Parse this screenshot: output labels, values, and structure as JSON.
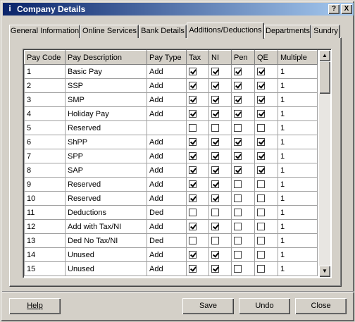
{
  "window": {
    "title": "Company Details",
    "help_btn": "?",
    "close_btn": "X",
    "title_icon": "i"
  },
  "tabs": [
    {
      "label": "General Information"
    },
    {
      "label": "Online Services"
    },
    {
      "label": "Bank Details"
    },
    {
      "label": "Additions/Deductions",
      "active": true
    },
    {
      "label": "Departments"
    },
    {
      "label": "Sundry"
    }
  ],
  "grid": {
    "headers": [
      "Pay Code",
      "Pay Description",
      "Pay Type",
      "Tax",
      "NI",
      "Pen",
      "QE",
      "Multiple"
    ],
    "rows": [
      {
        "code": "1",
        "desc": "Basic Pay",
        "type": "Add",
        "tax": true,
        "ni": true,
        "pen": true,
        "qe": true,
        "mult": "1"
      },
      {
        "code": "2",
        "desc": "SSP",
        "type": "Add",
        "tax": true,
        "ni": true,
        "pen": true,
        "qe": true,
        "mult": "1"
      },
      {
        "code": "3",
        "desc": "SMP",
        "type": "Add",
        "tax": true,
        "ni": true,
        "pen": true,
        "qe": true,
        "mult": "1"
      },
      {
        "code": "4",
        "desc": "Holiday Pay",
        "type": "Add",
        "tax": true,
        "ni": true,
        "pen": true,
        "qe": true,
        "mult": "1"
      },
      {
        "code": "5",
        "desc": "Reserved",
        "type": "",
        "tax": false,
        "ni": false,
        "pen": false,
        "qe": false,
        "mult": "1"
      },
      {
        "code": "6",
        "desc": "ShPP",
        "type": "Add",
        "tax": true,
        "ni": true,
        "pen": true,
        "qe": true,
        "mult": "1"
      },
      {
        "code": "7",
        "desc": "SPP",
        "type": "Add",
        "tax": true,
        "ni": true,
        "pen": true,
        "qe": true,
        "mult": "1"
      },
      {
        "code": "8",
        "desc": "SAP",
        "type": "Add",
        "tax": true,
        "ni": true,
        "pen": true,
        "qe": true,
        "mult": "1"
      },
      {
        "code": "9",
        "desc": "Reserved",
        "type": "Add",
        "tax": true,
        "ni": true,
        "pen": false,
        "qe": false,
        "mult": "1"
      },
      {
        "code": "10",
        "desc": "Reserved",
        "type": "Add",
        "tax": true,
        "ni": true,
        "pen": false,
        "qe": false,
        "mult": "1"
      },
      {
        "code": "11",
        "desc": "Deductions",
        "type": "Ded",
        "tax": false,
        "ni": false,
        "pen": false,
        "qe": false,
        "mult": "1"
      },
      {
        "code": "12",
        "desc": "Add with Tax/NI",
        "type": "Add",
        "tax": true,
        "ni": true,
        "pen": false,
        "qe": false,
        "mult": "1"
      },
      {
        "code": "13",
        "desc": "Ded No Tax/NI",
        "type": "Ded",
        "tax": false,
        "ni": false,
        "pen": false,
        "qe": false,
        "mult": "1"
      },
      {
        "code": "14",
        "desc": "Unused",
        "type": "Add",
        "tax": true,
        "ni": true,
        "pen": false,
        "qe": false,
        "mult": "1"
      },
      {
        "code": "15",
        "desc": "Unused",
        "type": "Add",
        "tax": true,
        "ni": true,
        "pen": false,
        "qe": false,
        "mult": "1"
      }
    ]
  },
  "buttons": {
    "help": "Help",
    "save": "Save",
    "undo": "Undo",
    "close": "Close"
  }
}
